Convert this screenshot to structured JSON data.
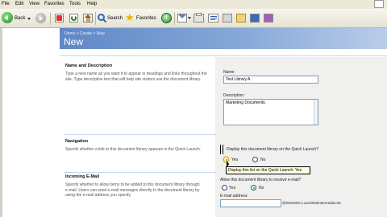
{
  "menubar": {
    "items": [
      "File",
      "Edit",
      "View",
      "Favorites",
      "Tools",
      "Help"
    ]
  },
  "toolbar": {
    "back_label": "Back",
    "search_label": "Search",
    "favorites_label": "Favorites"
  },
  "header": {
    "breadcrumb": "Demo > Create > New",
    "title": "New"
  },
  "sections": {
    "name_description": {
      "heading": "Name and Description",
      "description": "Type a new name as you want it to appear in headings and links throughout the site. Type descriptive text that will help site visitors use the document library.",
      "name_label": "Name:",
      "name_value": "Test Library A",
      "description_label": "Description:",
      "description_value": "Marketing Documents."
    },
    "navigation": {
      "heading": "Navigation",
      "description": "Specify whether a link to this document library appears in the Quick Launch.",
      "question": "Display this document library on the Quick Launch?",
      "yes_label": "Yes",
      "no_label": "No",
      "selected": "Yes",
      "tooltip": "Display this list on the Quick Launch: Yes"
    },
    "incoming_email": {
      "heading": "Incoming E-Mail",
      "description": "Specify whether to allow items to be added to this document library through e-mail. Users can send e-mail messages directly to the document library by using the e-mail address you specify.",
      "question": "Allow this document library to receive e-mail?",
      "yes_label": "Yes",
      "no_label": "No",
      "selected": "No",
      "email_label": "E-mail address:",
      "email_domain": "@WS2003-1.acch003intermedia.net"
    }
  },
  "colors": {
    "title_bar": "#5f88c7",
    "radio_selected": "#21a121"
  }
}
